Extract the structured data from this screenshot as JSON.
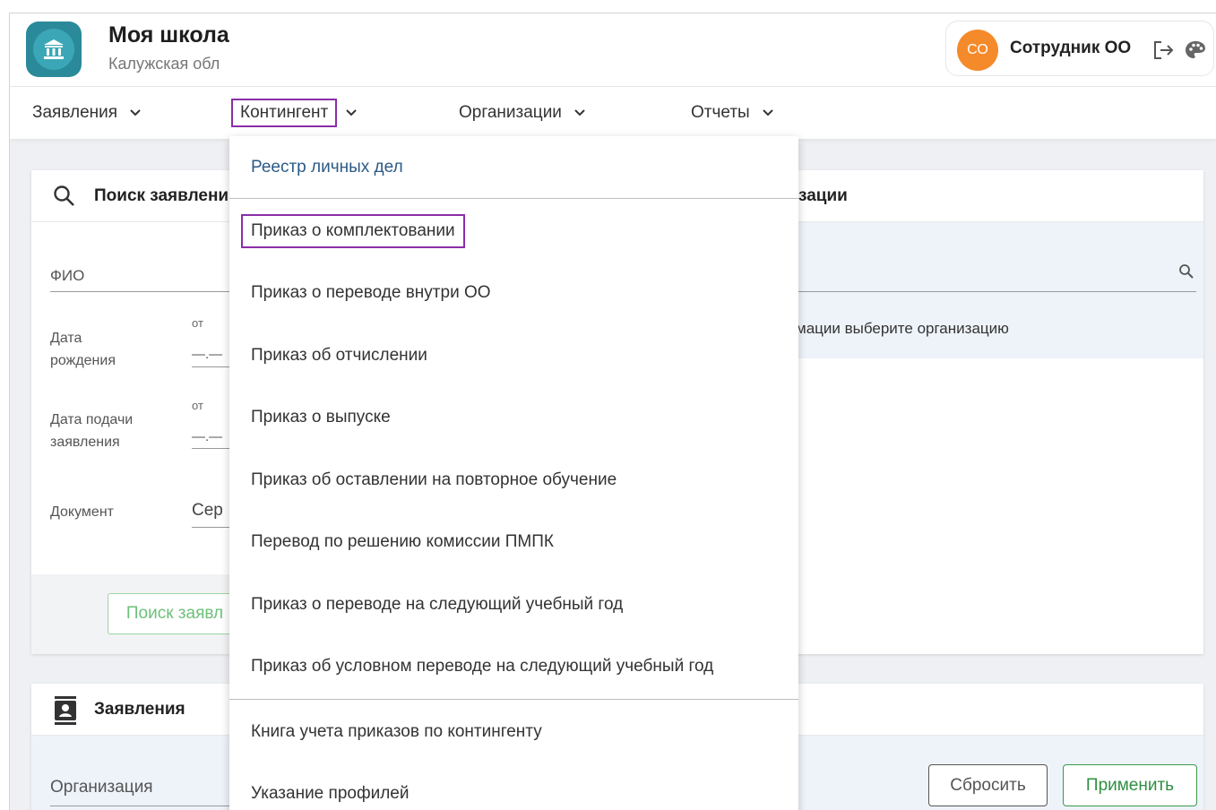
{
  "app": {
    "title": "Моя школа",
    "subtitle": "Калужская обл",
    "brand_color": "#2a8a9a"
  },
  "user": {
    "initials": "СО",
    "name": "Сотрудник ОО",
    "avatar_color": "#f58a2a"
  },
  "nav": {
    "items": [
      {
        "label": "Заявления"
      },
      {
        "label": "Контингент",
        "active": true
      },
      {
        "label": "Организации"
      },
      {
        "label": "Отчеты"
      }
    ]
  },
  "search_card": {
    "title_visible": "Поиск заявлени",
    "fio_label": "ФИО",
    "birth_label_1": "Дата",
    "birth_label_2": "рождения",
    "from_label": "от",
    "date_placeholder": "—.—",
    "submit_label_1": "Дата подачи",
    "submit_label_2": "заявления",
    "from_label_2": "от",
    "document_label": "Документ",
    "document_value": "Сер",
    "search_button": "Поиск заявл"
  },
  "org_card": {
    "title_visible": "зации",
    "hint_visible": "мации выберите организацию"
  },
  "applications_card": {
    "title": "Заявления",
    "org_label": "Организация",
    "reset_button": "Сбросить",
    "apply_button": "Применить"
  },
  "dropdown": {
    "items": [
      {
        "label": "Реестр личных дел"
      },
      {
        "label": "Приказ о комплектовании",
        "highlighted": true
      },
      {
        "label": "Приказ о переводе внутри ОО"
      },
      {
        "label": "Приказ об отчислении"
      },
      {
        "label": "Приказ о выпуске"
      },
      {
        "label": "Приказ об оставлении на повторное обучение"
      },
      {
        "label": "Перевод по решению комиссии ПМПК"
      },
      {
        "label": "Приказ о переводе на следующий учебный год"
      },
      {
        "label": "Приказ об условном переводе на следующий учебный год"
      },
      {
        "label": "Книга учета приказов по контингенту"
      },
      {
        "label": "Указание профилей"
      }
    ]
  }
}
